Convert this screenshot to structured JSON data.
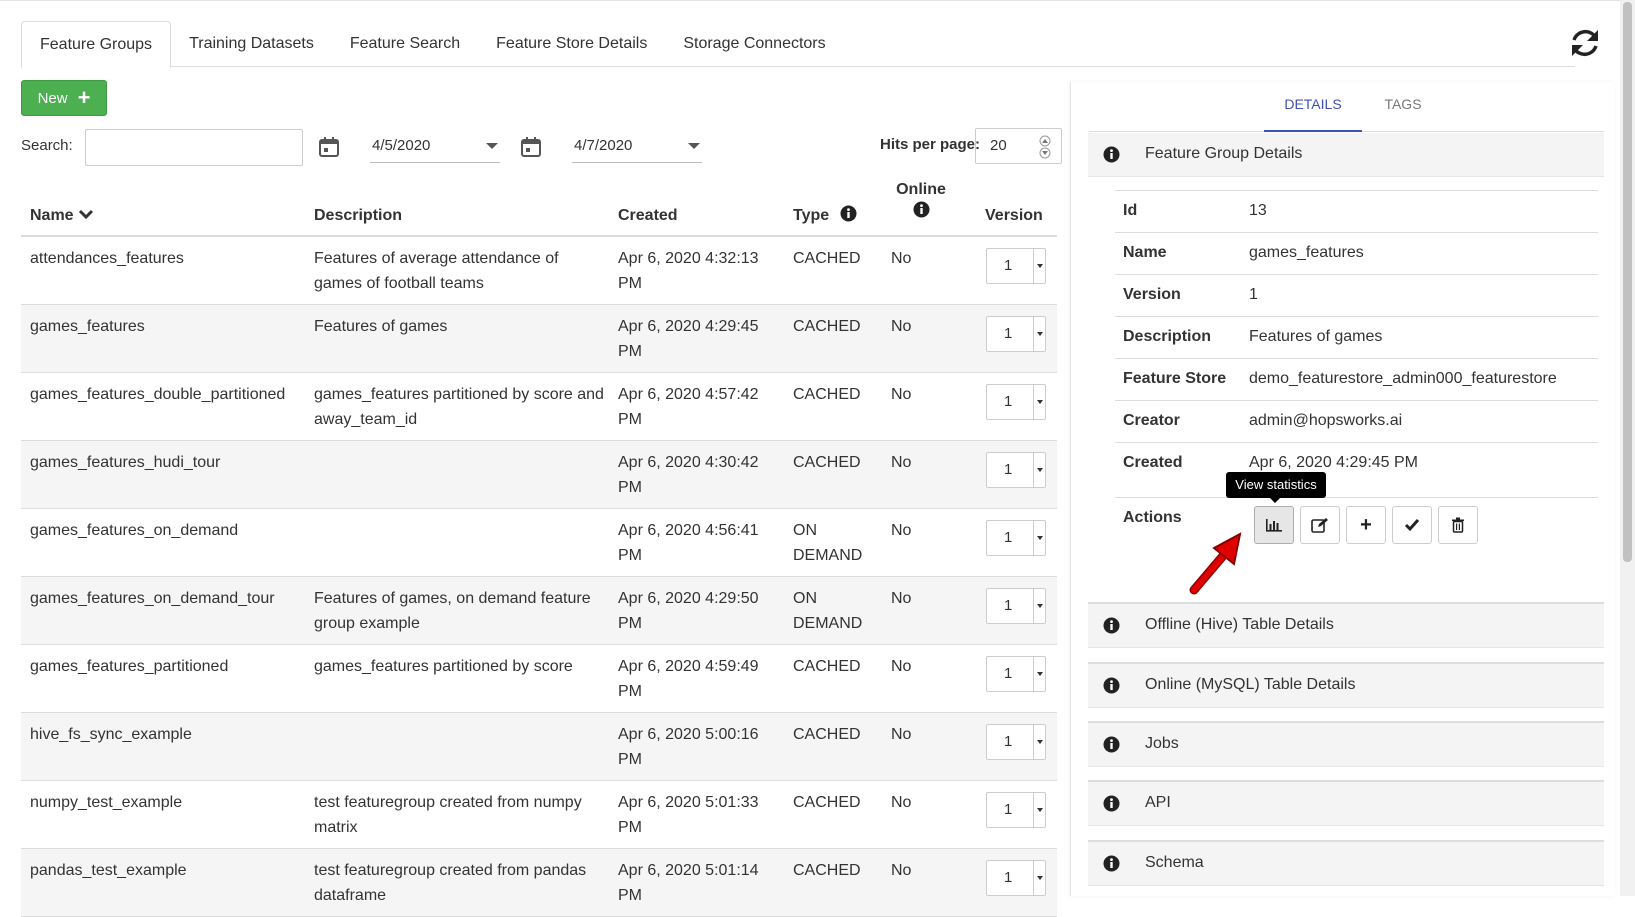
{
  "tabs": [
    "Feature Groups",
    "Training Datasets",
    "Feature Search",
    "Feature Store Details",
    "Storage Connectors"
  ],
  "toolbar": {
    "new_label": "New",
    "search_label": "Search:",
    "search_value": "",
    "date_from": "4/5/2020",
    "date_to": "4/7/2020",
    "hits_label": "Hits per page:",
    "hits_value": "20"
  },
  "table": {
    "headers": {
      "name": "Name",
      "description": "Description",
      "created": "Created",
      "type": "Type",
      "online": "Online",
      "version": "Version"
    },
    "rows": [
      {
        "name": "attendances_features",
        "description": "Features of average attendance of games of football teams",
        "created": "Apr 6, 2020 4:32:13 PM",
        "type": "CACHED",
        "online": "No",
        "version": "1"
      },
      {
        "name": "games_features",
        "description": "Features of games",
        "created": "Apr 6, 2020 4:29:45 PM",
        "type": "CACHED",
        "online": "No",
        "version": "1"
      },
      {
        "name": "games_features_double_partitioned",
        "description": "games_features partitioned by score and away_team_id",
        "created": "Apr 6, 2020 4:57:42 PM",
        "type": "CACHED",
        "online": "No",
        "version": "1"
      },
      {
        "name": "games_features_hudi_tour",
        "description": "",
        "created": "Apr 6, 2020 4:30:42 PM",
        "type": "CACHED",
        "online": "No",
        "version": "1"
      },
      {
        "name": "games_features_on_demand",
        "description": "",
        "created": "Apr 6, 2020 4:56:41 PM",
        "type": "ON DEMAND",
        "online": "No",
        "version": "1"
      },
      {
        "name": "games_features_on_demand_tour",
        "description": "Features of games, on demand feature group example",
        "created": "Apr 6, 2020 4:29:50 PM",
        "type": "ON DEMAND",
        "online": "No",
        "version": "1"
      },
      {
        "name": "games_features_partitioned",
        "description": "games_features partitioned by score",
        "created": "Apr 6, 2020 4:59:49 PM",
        "type": "CACHED",
        "online": "No",
        "version": "1"
      },
      {
        "name": "hive_fs_sync_example",
        "description": "",
        "created": "Apr 6, 2020 5:00:16 PM",
        "type": "CACHED",
        "online": "No",
        "version": "1"
      },
      {
        "name": "numpy_test_example",
        "description": "test featuregroup created from numpy matrix",
        "created": "Apr 6, 2020 5:01:33 PM",
        "type": "CACHED",
        "online": "No",
        "version": "1"
      },
      {
        "name": "pandas_test_example",
        "description": "test featuregroup created from pandas dataframe",
        "created": "Apr 6, 2020 5:01:14 PM",
        "type": "CACHED",
        "online": "No",
        "version": "1"
      }
    ]
  },
  "panel": {
    "tabs": [
      "DETAILS",
      "TAGS"
    ],
    "details_title": "Feature Group Details",
    "details": [
      {
        "key": "Id",
        "value": "13"
      },
      {
        "key": "Name",
        "value": "games_features"
      },
      {
        "key": "Version",
        "value": "1"
      },
      {
        "key": "Description",
        "value": "Features of games"
      },
      {
        "key": "Feature Store",
        "value": "demo_featurestore_admin000_featurestore"
      },
      {
        "key": "Creator",
        "value": "admin@hopsworks.ai"
      },
      {
        "key": "Created",
        "value": "Apr 6, 2020 4:29:45 PM"
      }
    ],
    "actions_label": "Actions",
    "tooltip": "View statistics",
    "sections": [
      "Offline (Hive) Table Details",
      "Online (MySQL) Table Details",
      "Jobs",
      "API",
      "Schema"
    ]
  },
  "colors": {
    "accent": "#3f51b5",
    "new_button": "#4caf50",
    "arrow": "#e00000"
  }
}
